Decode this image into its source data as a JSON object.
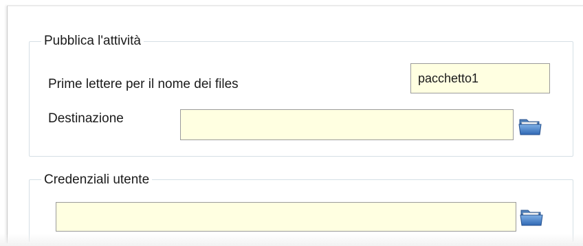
{
  "publish_group": {
    "title": "Pubblica l'attività",
    "prefix_label": "Prime lettere per il nome dei files",
    "prefix_value": "pacchetto1",
    "destination_label": "Destinazione",
    "destination_value": ""
  },
  "credentials_group": {
    "title": "Credenziali utente",
    "path_value": ""
  },
  "icons": {
    "browse": "folder-icon"
  },
  "colors": {
    "field_background": "#ffffe1",
    "group_border": "#d5dfe5",
    "folder_blue": "#3f7fc9"
  }
}
